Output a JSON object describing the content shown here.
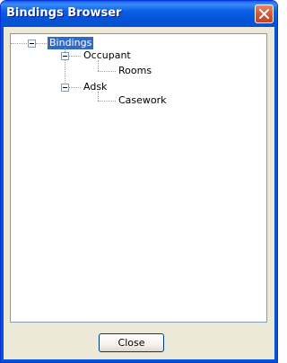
{
  "window": {
    "title": "Bindings Browser",
    "close_icon": "close-icon"
  },
  "tree": {
    "root": {
      "label": "Bindings",
      "selected": true,
      "expanded": true,
      "children": [
        {
          "label": "Occupant",
          "expanded": true,
          "children": [
            {
              "label": "Rooms"
            }
          ]
        },
        {
          "label": "Adsk",
          "expanded": true,
          "children": [
            {
              "label": "Casework"
            }
          ]
        }
      ]
    }
  },
  "buttons": {
    "close_label": "Close"
  },
  "colors": {
    "titlebar": "#0554d8",
    "selection": "#316ac5",
    "close_button": "#d95a3a",
    "dialog_bg": "#ece9d8"
  }
}
